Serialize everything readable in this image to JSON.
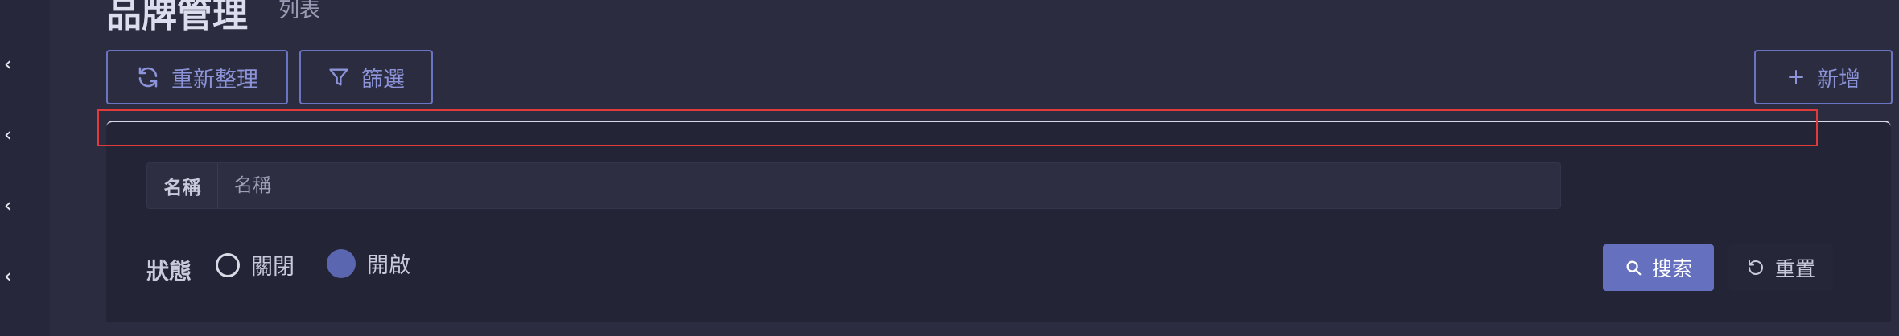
{
  "page": {
    "title": "品牌管理",
    "subtitle": "列表"
  },
  "sidebar": {
    "collapse_icons": [
      "chevron-left-icon",
      "chevron-left-icon",
      "chevron-left-icon",
      "chevron-left-icon"
    ]
  },
  "toolbar": {
    "refresh_label": "重新整理",
    "filter_label": "篩選",
    "add_label": "新增"
  },
  "filter_panel": {
    "name_label": "名稱",
    "name_value": "",
    "name_placeholder": "名稱",
    "status_label": "狀態",
    "status_options": [
      {
        "label": "關閉",
        "selected": false
      },
      {
        "label": "開啟",
        "selected": true
      }
    ],
    "search_label": "搜索",
    "reset_label": "重置"
  },
  "colors": {
    "accent": "#6570bf",
    "highlight_border": "#e03a3a",
    "background": "#2b2c40"
  }
}
